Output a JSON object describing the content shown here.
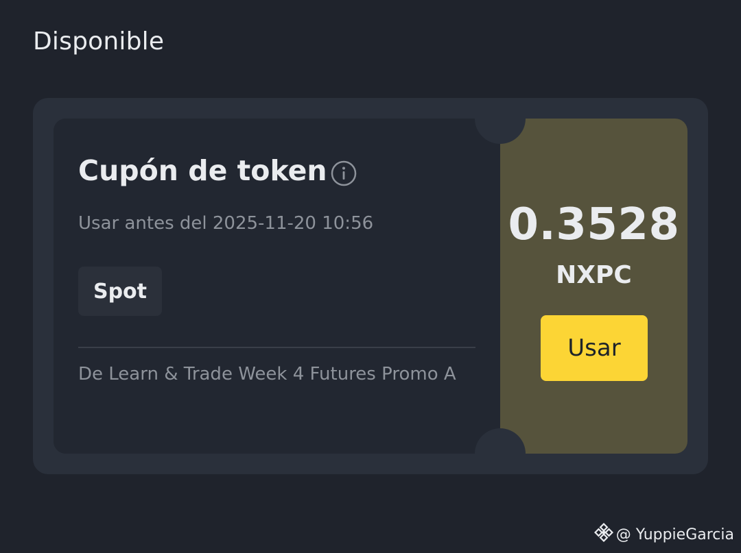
{
  "section": {
    "title": "Disponible"
  },
  "coupon": {
    "title": "Cupón de token",
    "info_icon": "info-circle-icon",
    "expiry": "Usar antes del 2025-11-20 10:56",
    "tag": "Spot",
    "source": "De Learn & Trade Week 4 Futures Promo A",
    "amount": "0.3528",
    "currency": "NXPC",
    "use_label": "Usar"
  },
  "watermark": {
    "icon": "binance-logo-icon",
    "text": "@ YuppieGarcia"
  },
  "colors": {
    "background": "#1f232c",
    "card": "#2a303b",
    "ticket": "#222731",
    "ticket_right": "#56533c",
    "accent": "#fcd535",
    "muted_text": "#8e939b"
  }
}
